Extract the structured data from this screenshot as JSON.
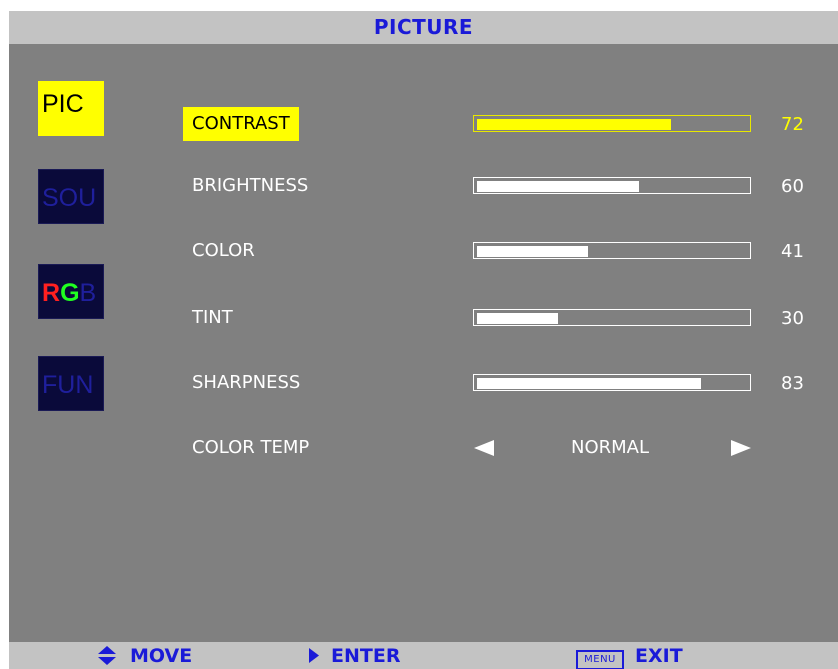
{
  "title": "PICTURE",
  "tabs": [
    {
      "id": "pic",
      "label": "PIC",
      "active": true
    },
    {
      "id": "sou",
      "label": "SOU",
      "active": false
    },
    {
      "id": "rgb",
      "label": "RGB",
      "colored_letters": [
        {
          "char": "R",
          "color": "#ff2020"
        },
        {
          "char": "G",
          "color": "#20ff20"
        },
        {
          "char": "B",
          "color": "#1f1f9c"
        }
      ],
      "active": false
    },
    {
      "id": "fun",
      "label": "FUN",
      "active": false
    }
  ],
  "settings": [
    {
      "label": "CONTRAST",
      "value": "72",
      "level": 72,
      "selected": true
    },
    {
      "label": "BRIGHTNESS",
      "value": "60",
      "level": 60,
      "selected": false
    },
    {
      "label": "COLOR",
      "value": "41",
      "level": 41,
      "selected": false
    },
    {
      "label": "TINT",
      "value": "30",
      "level": 30,
      "selected": false
    },
    {
      "label": "SHARPNESS",
      "value": "83",
      "level": 83,
      "selected": false
    }
  ],
  "color_temp": {
    "label": "COLOR TEMP",
    "value": "NORMAL"
  },
  "hints": {
    "move": "MOVE",
    "enter": "ENTER",
    "menu_key": "MENU",
    "exit": "EXIT"
  },
  "colors": {
    "panel": "#808080",
    "bars": "#c3c3c3",
    "accent_text": "#1a1ad8",
    "highlight": "#ffff00"
  },
  "icons": [
    "up-down-arrow-icon",
    "right-triangle-icon",
    "left-arrow-icon",
    "right-arrow-icon"
  ]
}
